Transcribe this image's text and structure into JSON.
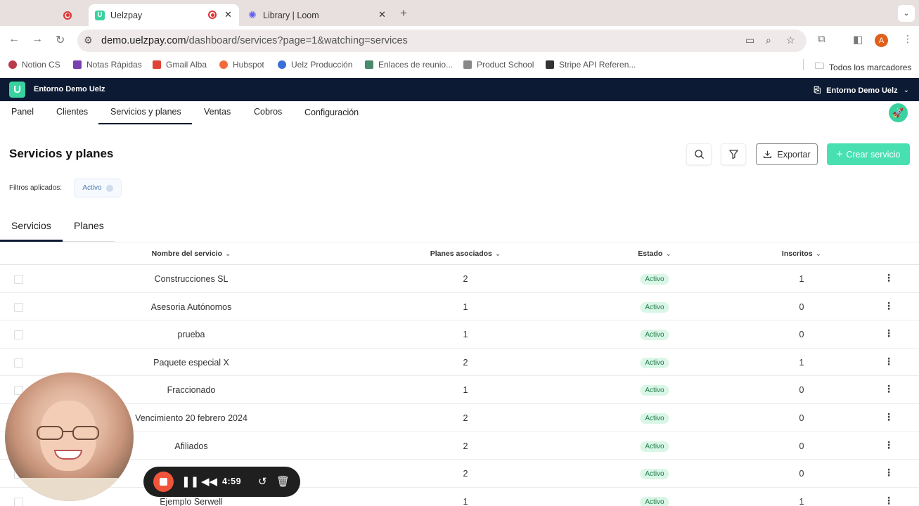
{
  "browser": {
    "tabs": [
      {
        "title": ""
      },
      {
        "title": "Uelzpay",
        "active": true
      },
      {
        "title": "Library | Loom"
      }
    ],
    "new_tab_symbol": "+",
    "url_host": "demo.uelzpay.com",
    "url_path": "/dashboard/services?page=1&watching=services",
    "profile_initial": "A",
    "bookmarks": [
      "Notion CS",
      "Notas Rápidas",
      "Gmail Alba",
      "Hubspot",
      "Uelz Producción",
      "Enlaces de reunio...",
      "Product School",
      "Stripe API Referen..."
    ],
    "all_bookmarks": "Todos los marcadores"
  },
  "app": {
    "logo_letter": "U",
    "env_title": "Entorno Demo Uelz",
    "env_switcher": "Entorno Demo Uelz",
    "nav": [
      "Panel",
      "Clientes",
      "Servicios y planes",
      "Ventas",
      "Cobros",
      "Configuración"
    ],
    "page_title": "Servicios y planes",
    "export_label": "Exportar",
    "create_label": "Crear servicio",
    "filters_label": "Filtros aplicados:",
    "filter_chip": "Activo",
    "subtabs": [
      "Servicios",
      "Planes"
    ],
    "columns": [
      "Nombre del servicio",
      "Planes asociados",
      "Estado",
      "Inscritos"
    ],
    "rows": [
      {
        "name": "Construcciones SL",
        "plans": "2",
        "status": "Activo",
        "enrolled": "1"
      },
      {
        "name": "Asesoria Autónomos",
        "plans": "1",
        "status": "Activo",
        "enrolled": "0"
      },
      {
        "name": "prueba",
        "plans": "1",
        "status": "Activo",
        "enrolled": "0"
      },
      {
        "name": "Paquete especial X",
        "plans": "2",
        "status": "Activo",
        "enrolled": "1"
      },
      {
        "name": "Fraccionado",
        "plans": "1",
        "status": "Activo",
        "enrolled": "0"
      },
      {
        "name": "Vencimiento 20 febrero 2024",
        "plans": "2",
        "status": "Activo",
        "enrolled": "0"
      },
      {
        "name": "Afiliados",
        "plans": "2",
        "status": "Activo",
        "enrolled": "0"
      },
      {
        "name": "",
        "plans": "2",
        "status": "Activo",
        "enrolled": "0"
      },
      {
        "name": "Ejemplo Serwell",
        "plans": "1",
        "status": "Activo",
        "enrolled": "1"
      }
    ]
  },
  "loom": {
    "timer": "4:59"
  },
  "colors": {
    "brand_dark": "#0d1a33",
    "brand_green": "#3ad1a0",
    "create_button": "#49e0b1",
    "badge_bg": "#d9f6e6",
    "badge_text": "#1f7a47",
    "record_red": "#f0553b"
  },
  "icons": [
    "recording-icon",
    "close-icon",
    "loom-icon",
    "back-icon",
    "forward-icon",
    "reload-icon",
    "site-settings-icon",
    "camera-icon",
    "zoom-icon",
    "star-icon",
    "extensions-icon",
    "sidebar-icon",
    "menu-dots-icon",
    "folder-icon",
    "search-icon",
    "filter-icon",
    "download-icon",
    "plus-icon",
    "chevron-down-icon",
    "rocket-icon",
    "kebab-icon",
    "pause-icon",
    "rewind-icon",
    "restart-icon",
    "trash-icon"
  ]
}
